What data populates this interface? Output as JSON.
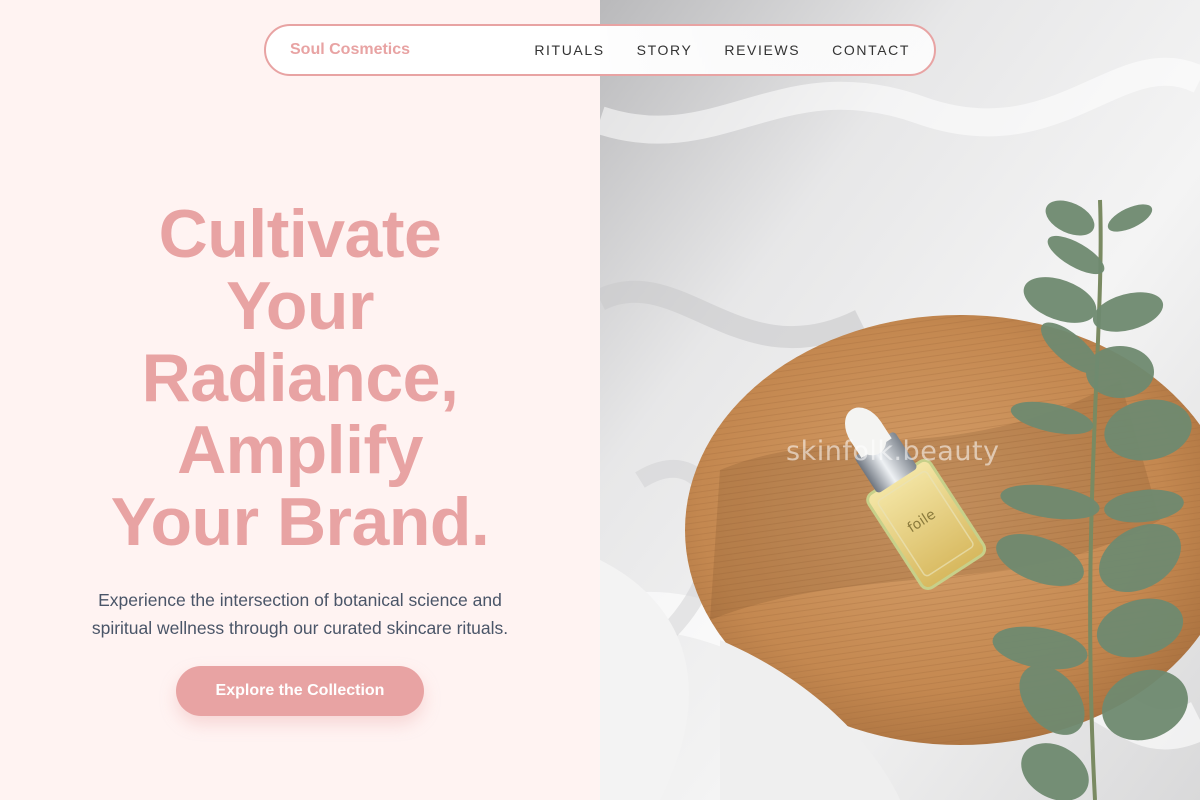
{
  "brand": {
    "name": "Soul Cosmetics"
  },
  "nav": {
    "links": [
      "RITUALS",
      "STORY",
      "REVIEWS",
      "CONTACT"
    ]
  },
  "hero": {
    "title_lines": [
      "Cultivate",
      "Your",
      "Radiance,",
      "Amplify",
      "Your Brand."
    ],
    "subtitle": "Experience the intersection of botanical science and spiritual wellness through our curated skincare rituals.",
    "cta_label": "Explore the Collection"
  },
  "photo": {
    "watermark": "skinfolk.beauty",
    "bottle_label": "foile"
  },
  "colors": {
    "accent": "#e8a3a3",
    "background": "#fff3f2",
    "text": "#4a5568"
  }
}
